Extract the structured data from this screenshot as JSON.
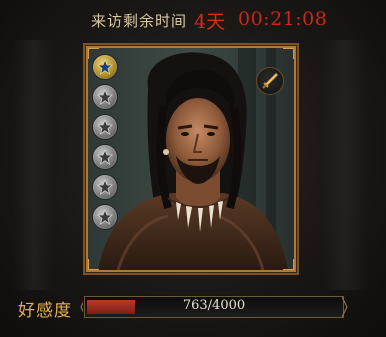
{
  "header": {
    "label": "来访剩余时间",
    "days": "4天",
    "time": "00:21:08"
  },
  "stars": [
    {
      "icon": "star-icon",
      "active": true
    },
    {
      "icon": "star-icon",
      "active": false
    },
    {
      "icon": "star-icon",
      "active": false
    },
    {
      "icon": "star-icon",
      "active": false
    },
    {
      "icon": "star-icon",
      "active": false
    },
    {
      "icon": "star-icon",
      "active": false
    }
  ],
  "badge_icon": "sword-icon",
  "affection": {
    "label": "好感度",
    "current": 763,
    "max": 4000,
    "text": "763/4000"
  },
  "colors": {
    "timer_red": "#d32c1e",
    "label_gold": "#e3b24a",
    "frame_gold": "#b07a35",
    "bar_fill": "#b63a2c"
  }
}
